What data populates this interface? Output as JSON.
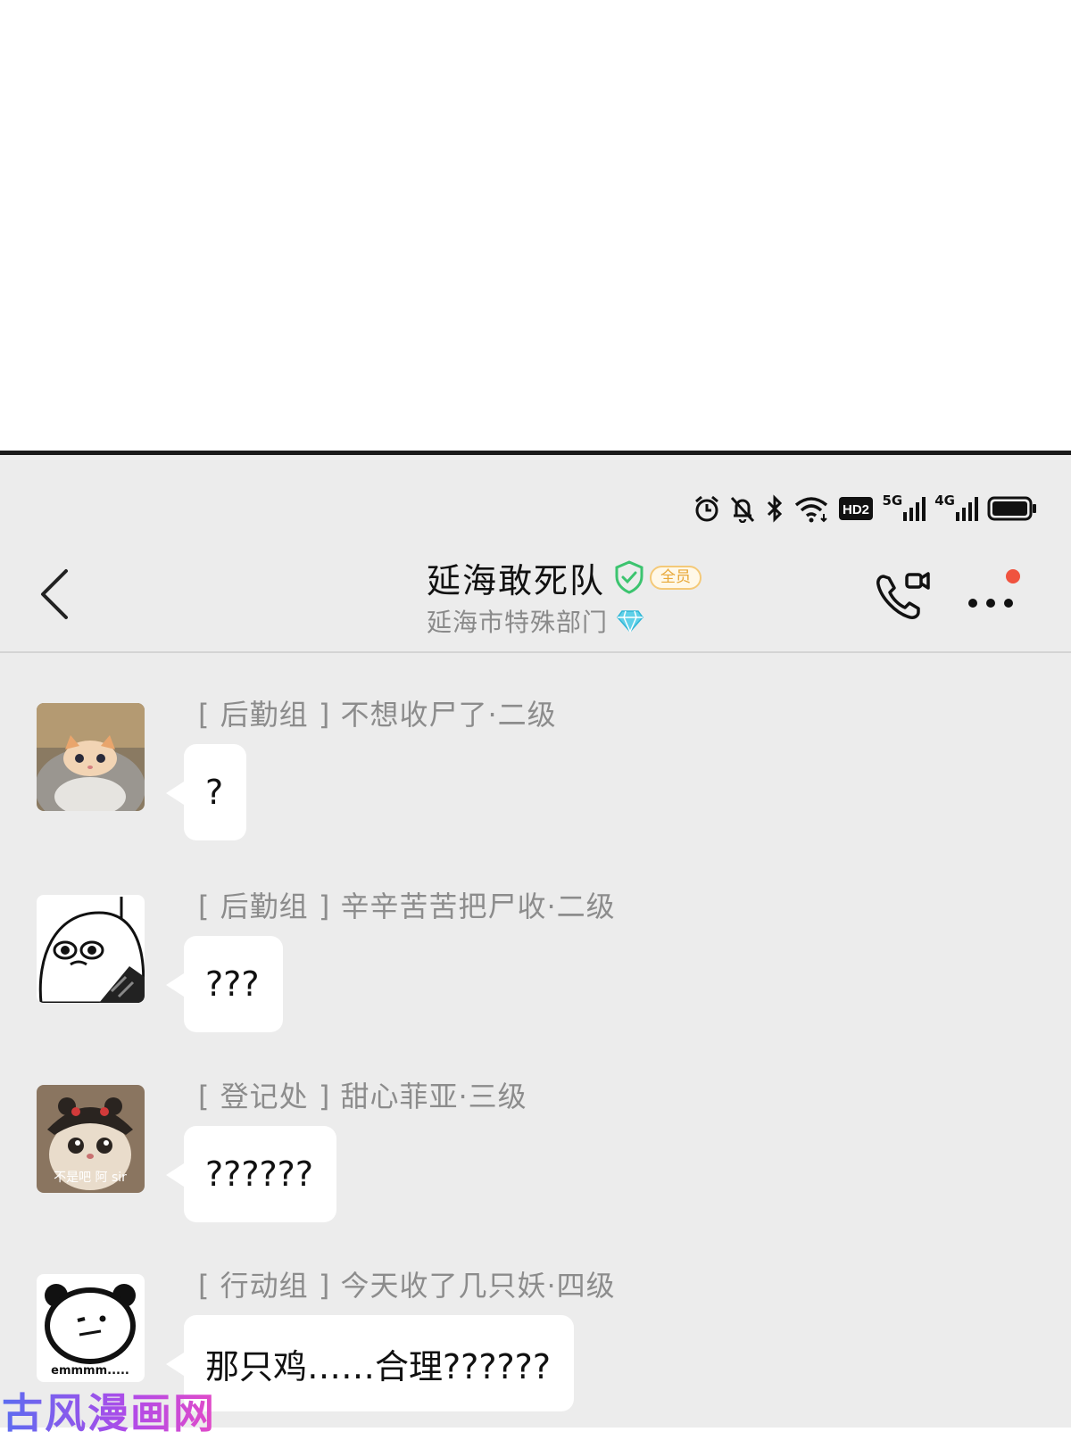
{
  "status_bar": {
    "icons": [
      "alarm-icon",
      "bell-off-icon",
      "bluetooth-icon",
      "wifi-icon",
      "hd-icon",
      "signal-5g-icon",
      "signal-4g-icon",
      "battery-icon"
    ],
    "hd_label": "HD2",
    "net1_label": "5G",
    "net2_label": "4G"
  },
  "header": {
    "title": "延海敢死队",
    "badge": "全员",
    "subtitle": "延海市特殊部门",
    "accent_green": "#3cc46f",
    "badge_color": "#e8a838",
    "notification_dot_color": "#f0533f"
  },
  "messages": [
    {
      "sender": "[ 后勤组 ] 不想收尸了·二级",
      "text": "?",
      "avatar": "cat-in-pot-avatar"
    },
    {
      "sender": "[ 后勤组 ] 辛辛苦苦把尸收·二级",
      "text": "???",
      "avatar": "crying-cartoon-avatar"
    },
    {
      "sender": "[ 登记处 ] 甜心菲亚·三级",
      "text": "??????",
      "avatar": "cat-with-hat-avatar",
      "avatar_caption": "不是吧 阿 sir"
    },
    {
      "sender": "[ 行动组 ] 今天收了几只妖·四级",
      "text": "那只鸡……合理??????",
      "avatar": "panda-meme-avatar",
      "avatar_caption": "emmmm....."
    }
  ],
  "watermark": "古风漫画网"
}
